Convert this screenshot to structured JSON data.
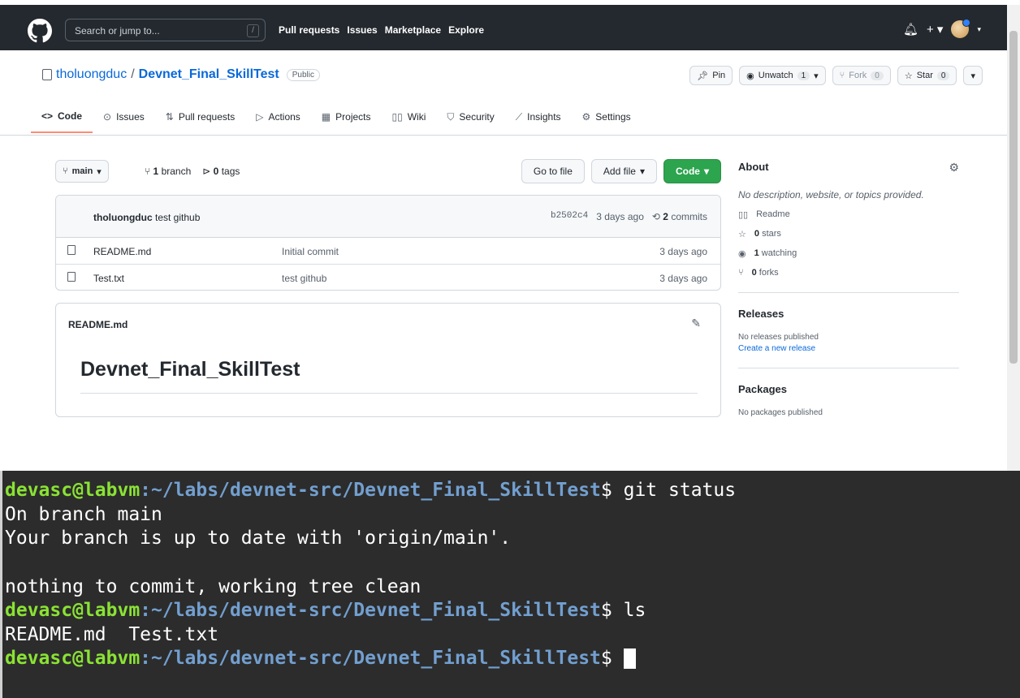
{
  "header": {
    "search_placeholder": "Search or jump to...",
    "search_shortcut": "/",
    "nav": [
      "Pull requests",
      "Issues",
      "Marketplace",
      "Explore"
    ]
  },
  "repo": {
    "owner": "tholuongduc",
    "separator": "/",
    "name": "Devnet_Final_SkillTest",
    "visibility": "Public",
    "actions": {
      "pin": "Pin",
      "unwatch": "Unwatch",
      "unwatch_count": "1",
      "fork": "Fork",
      "fork_count": "0",
      "star": "Star",
      "star_count": "0"
    }
  },
  "tabs": [
    {
      "label": "Code",
      "icon": "code-icon"
    },
    {
      "label": "Issues",
      "icon": "issue-icon"
    },
    {
      "label": "Pull requests",
      "icon": "pull-request-icon"
    },
    {
      "label": "Actions",
      "icon": "play-icon"
    },
    {
      "label": "Projects",
      "icon": "table-icon"
    },
    {
      "label": "Wiki",
      "icon": "book-icon"
    },
    {
      "label": "Security",
      "icon": "shield-icon"
    },
    {
      "label": "Insights",
      "icon": "graph-icon"
    },
    {
      "label": "Settings",
      "icon": "gear-icon"
    }
  ],
  "filenav": {
    "branch": "main",
    "branches_count": "1",
    "branches_label": "branch",
    "tags_count": "0",
    "tags_label": "tags",
    "go_to_file": "Go to file",
    "add_file": "Add file",
    "code": "Code"
  },
  "commit": {
    "author": "tholuongduc",
    "message": "test github",
    "sha": "b2502c4",
    "age": "3 days ago",
    "count": "2",
    "count_label": "commits"
  },
  "files": [
    {
      "name": "README.md",
      "message": "Initial commit",
      "age": "3 days ago"
    },
    {
      "name": "Test.txt",
      "message": "test github",
      "age": "3 days ago"
    }
  ],
  "readme": {
    "filename": "README.md",
    "heading": "Devnet_Final_SkillTest"
  },
  "sidebar": {
    "about_title": "About",
    "description": "No description, website, or topics provided.",
    "readme": "Readme",
    "stars_count": "0",
    "stars_label": "stars",
    "watching_count": "1",
    "watching_label": "watching",
    "forks_count": "0",
    "forks_label": "forks",
    "releases_title": "Releases",
    "releases_none": "No releases published",
    "create_release": "Create a new release",
    "packages_title": "Packages",
    "packages_none": "No packages published"
  },
  "terminal": {
    "prompt_user": "devasc@labvm",
    "prompt_path": ":~/labs/devnet-src/Devnet_Final_SkillTest",
    "prompt_end": "$ ",
    "lines": [
      {
        "type": "prompt",
        "cmd": "git status"
      },
      {
        "type": "out",
        "text": "On branch main"
      },
      {
        "type": "out",
        "text": "Your branch is up to date with 'origin/main'."
      },
      {
        "type": "blank",
        "text": ""
      },
      {
        "type": "out",
        "text": "nothing to commit, working tree clean"
      },
      {
        "type": "prompt",
        "cmd": "ls"
      },
      {
        "type": "out",
        "text": "README.md  Test.txt"
      },
      {
        "type": "prompt",
        "cmd": ""
      }
    ]
  },
  "colors": {
    "header_bg": "#24292f",
    "link": "#0969da",
    "green_button": "#2da44e",
    "active_tab_underline": "#fd8c73",
    "terminal_bg": "#2c2c2c",
    "prompt_user": "#8ae234",
    "prompt_path": "#729fcf"
  }
}
